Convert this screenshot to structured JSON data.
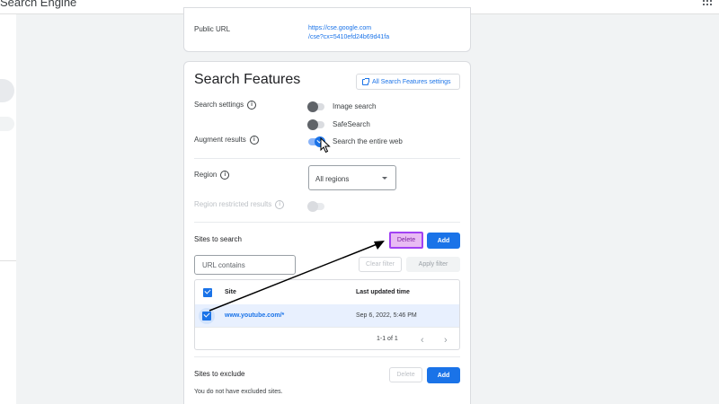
{
  "app": {
    "title": "Search Engine",
    "apps_icon": "apps-grid-icon"
  },
  "overview": {
    "public_url_label": "Public URL",
    "public_url_line1": "https://cse.google.com",
    "public_url_line2": "/cse?cx=5410efd24b69d41fa"
  },
  "search_features": {
    "title": "Search Features",
    "all_settings_button": "All Search Features settings",
    "search_settings_label": "Search settings",
    "image_search_label": "Image search",
    "image_search_on": false,
    "safesearch_label": "SafeSearch",
    "safesearch_on": false,
    "augment_results_label": "Augment results",
    "search_entire_web_label": "Search the entire web",
    "search_entire_web_on": true,
    "region_label": "Region",
    "region_value": "All regions",
    "region_restricted_label": "Region restricted results",
    "region_restricted_enabled": false
  },
  "sites_to_search": {
    "label": "Sites to search",
    "delete_button": "Delete",
    "add_button": "Add",
    "url_placeholder": "URL contains",
    "clear_filter_button": "Clear filter",
    "apply_filter_button": "Apply filter",
    "columns": [
      "Site",
      "Last updated time"
    ],
    "rows": [
      {
        "site": "www.youtube.com/*",
        "updated": "Sep 6, 2022, 5:46 PM",
        "selected": true
      }
    ],
    "pagination": "1-1 of 1"
  },
  "sites_to_exclude": {
    "label": "Sites to exclude",
    "delete_button": "Delete",
    "add_button": "Add",
    "empty_message": "You do not have excluded sites."
  },
  "colors": {
    "accent": "#1a73e8",
    "highlight": "#a142f4",
    "annotation_arrow": "#000000"
  }
}
